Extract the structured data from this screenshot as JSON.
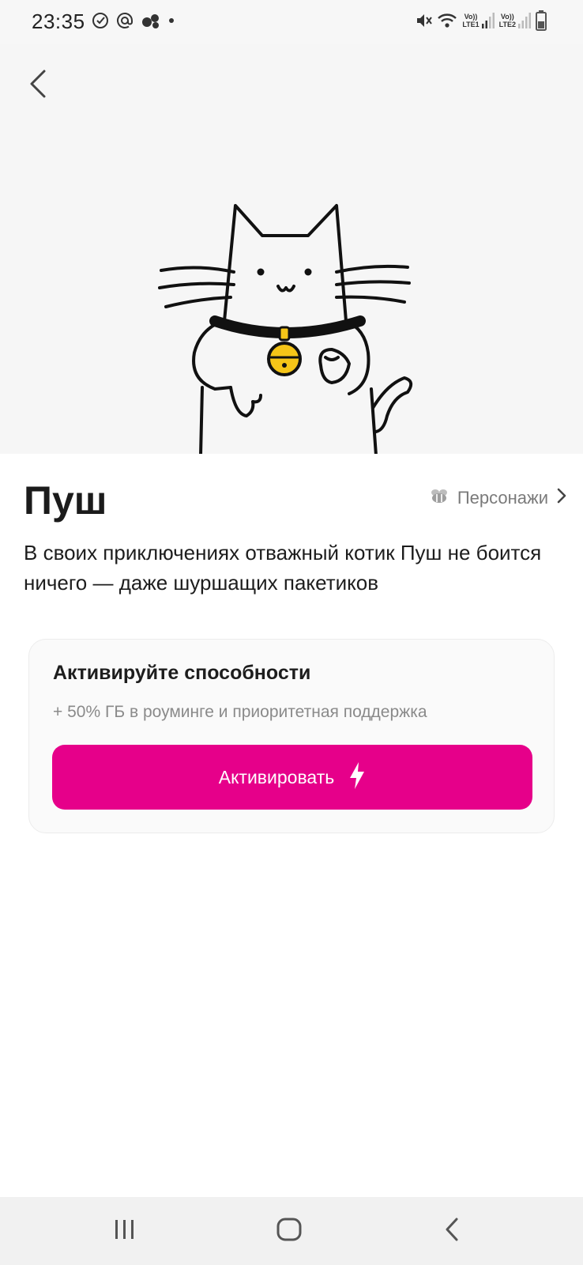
{
  "status_bar": {
    "time": "23:35",
    "left_icons": [
      "checkmark-circle-icon",
      "at-sign-icon",
      "messenger-icon",
      "dot-icon"
    ],
    "right_icons": [
      "mute-icon",
      "wifi-icon",
      "lte1-signal-icon",
      "lte2-signal-icon",
      "battery-icon"
    ],
    "sim1_label": "LTE1",
    "sim2_label": "LTE2",
    "volte_label": "Vo))"
  },
  "hero": {
    "back_icon": "chevron-left-icon",
    "illustration": "cat-with-bell-illustration",
    "bg_color": "#f6f6f6"
  },
  "character": {
    "name": "Пуш",
    "characters_link": "Персонажи",
    "description": "В своих приключениях отважный котик Пуш не боится ничего — даже шуршащих пакетиков"
  },
  "card": {
    "title": "Активируйте способности",
    "subtitle": "+ 50% ГБ в роуминге и приоритетная поддержка",
    "button_label": "Активировать",
    "button_icon": "lightning-icon",
    "accent_color": "#e6008a"
  },
  "nav": {
    "recents_icon": "recents-icon",
    "home_icon": "home-icon",
    "back_icon": "back-icon"
  }
}
